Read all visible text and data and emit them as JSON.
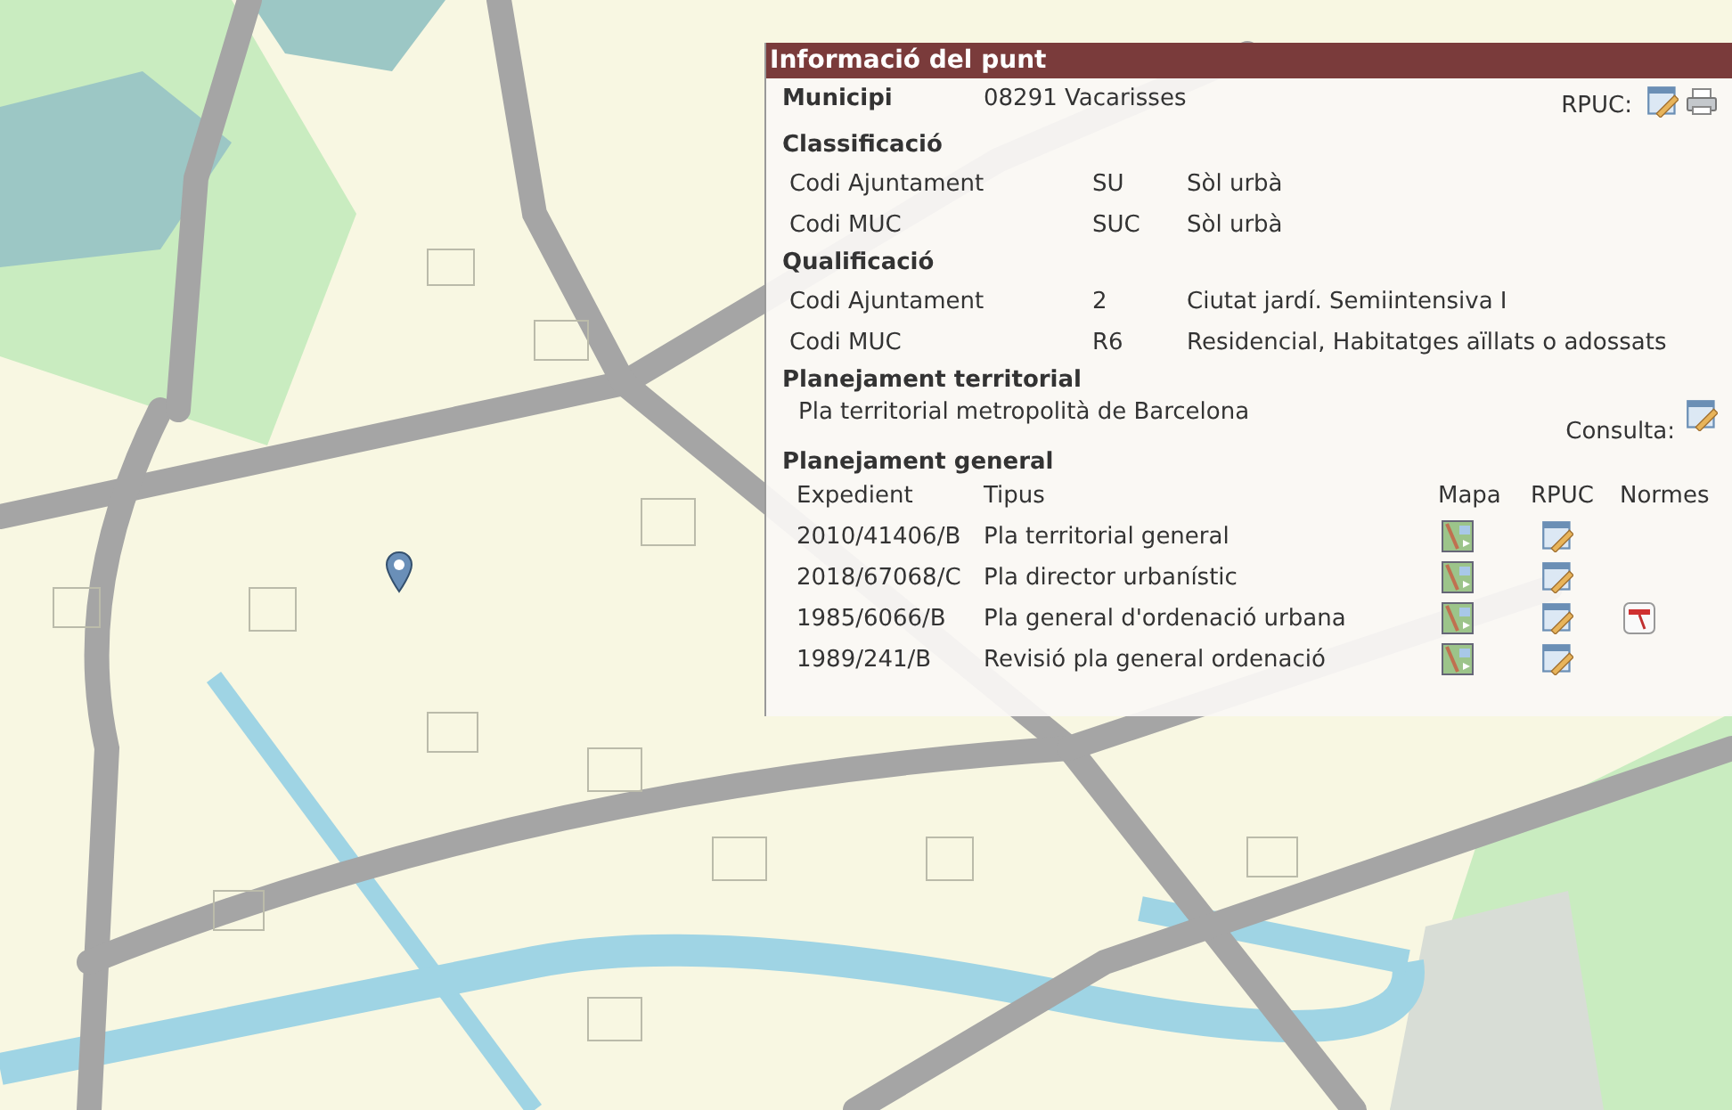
{
  "panel": {
    "title": "Informació del punt",
    "municipi": {
      "label": "Municipi",
      "value": "08291 Vacarisses",
      "rpuc_label": "RPUC:"
    },
    "classificacio": {
      "heading": "Classificació",
      "rows": [
        {
          "label": "Codi Ajuntament",
          "code": "SU",
          "description": "Sòl urbà"
        },
        {
          "label": "Codi MUC",
          "code": "SUC",
          "description": "Sòl urbà"
        }
      ]
    },
    "qualificacio": {
      "heading": "Qualificació",
      "rows": [
        {
          "label": "Codi Ajuntament",
          "code": "2",
          "description": "Ciutat jardí. Semiintensiva I"
        },
        {
          "label": "Codi MUC",
          "code": "R6",
          "description": "Residencial, Habitatges aïllats o adossats"
        }
      ]
    },
    "planejament_territorial": {
      "heading": "Planejament territorial",
      "name": "Pla territorial metropolità de Barcelona",
      "consulta_label": "Consulta:"
    },
    "planejament_general": {
      "heading": "Planejament general",
      "columns": [
        "Expedient",
        "Tipus",
        "Mapa",
        "RPUC",
        "Normes"
      ],
      "rows": [
        {
          "expedient": "2010/41406/B",
          "tipus": "Pla territorial general",
          "normes": false
        },
        {
          "expedient": "2018/67068/C",
          "tipus": "Pla director urbanístic",
          "normes": false
        },
        {
          "expedient": "1985/6066/B",
          "tipus": "Pla general d'ordenació urbana",
          "normes": true
        },
        {
          "expedient": "1989/241/B",
          "tipus": "Revisió pla general ordenació",
          "normes": false
        }
      ]
    }
  }
}
